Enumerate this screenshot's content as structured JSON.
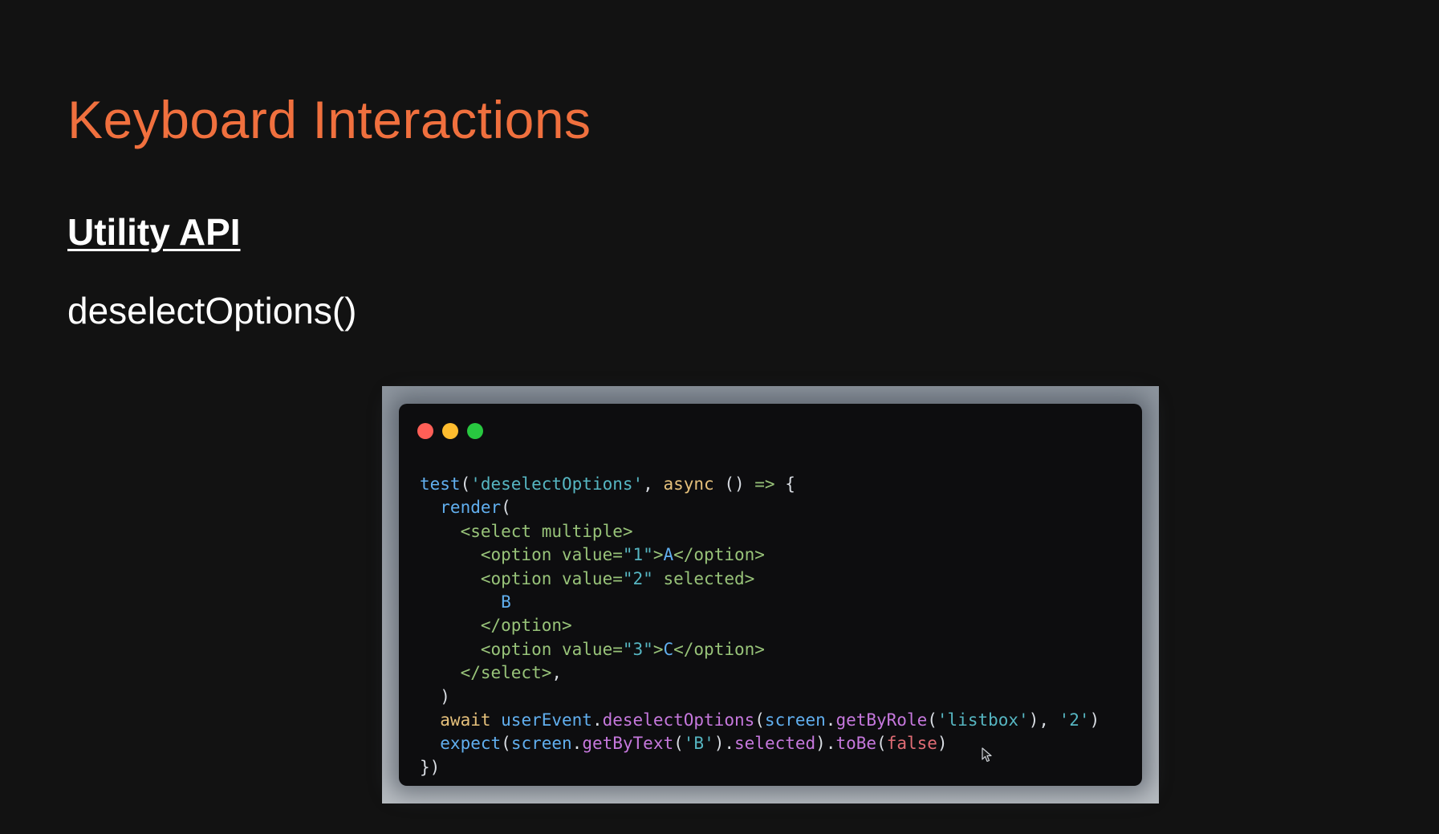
{
  "slide": {
    "title": "Keyboard Interactions",
    "heading": "Utility API",
    "api_name": "deselectOptions()"
  },
  "colors": {
    "background": "#121212",
    "title": "#f0703e",
    "frame": "#9aa1a9",
    "editor_bg": "#0d0d0f",
    "close_dot": "#ff5f57",
    "minimize_dot": "#febc2e",
    "zoom_dot": "#28c840"
  },
  "code_window": {
    "traffic_lights": [
      {
        "name": "close-dot",
        "color": "#ff5f57"
      },
      {
        "name": "minimize-dot",
        "color": "#febc2e"
      },
      {
        "name": "zoom-dot",
        "color": "#28c840"
      }
    ],
    "lines": [
      [
        {
          "t": "test",
          "c": "#61afef"
        },
        {
          "t": "(",
          "c": "#d9dde3"
        },
        {
          "t": "'deselectOptions'",
          "c": "#56b6c2"
        },
        {
          "t": ", ",
          "c": "#d9dde3"
        },
        {
          "t": "async",
          "c": "#e5c07b"
        },
        {
          "t": " () ",
          "c": "#d9dde3"
        },
        {
          "t": "=>",
          "c": "#98c379"
        },
        {
          "t": " {",
          "c": "#d9dde3"
        }
      ],
      [
        {
          "t": "  render",
          "c": "#61afef"
        },
        {
          "t": "(",
          "c": "#d9dde3"
        }
      ],
      [
        {
          "t": "    <select multiple>",
          "c": "#98c379"
        }
      ],
      [
        {
          "t": "      <option value=",
          "c": "#98c379"
        },
        {
          "t": "\"1\"",
          "c": "#56b6c2"
        },
        {
          "t": ">",
          "c": "#98c379"
        },
        {
          "t": "A",
          "c": "#61afef"
        },
        {
          "t": "</option>",
          "c": "#98c379"
        }
      ],
      [
        {
          "t": "      <option value=",
          "c": "#98c379"
        },
        {
          "t": "\"2\"",
          "c": "#56b6c2"
        },
        {
          "t": " selected>",
          "c": "#98c379"
        }
      ],
      [
        {
          "t": "        B",
          "c": "#61afef"
        }
      ],
      [
        {
          "t": "      </option>",
          "c": "#98c379"
        }
      ],
      [
        {
          "t": "      <option value=",
          "c": "#98c379"
        },
        {
          "t": "\"3\"",
          "c": "#56b6c2"
        },
        {
          "t": ">",
          "c": "#98c379"
        },
        {
          "t": "C",
          "c": "#61afef"
        },
        {
          "t": "</option>",
          "c": "#98c379"
        }
      ],
      [
        {
          "t": "    </select>",
          "c": "#98c379"
        },
        {
          "t": ",",
          "c": "#d9dde3"
        }
      ],
      [
        {
          "t": "  )",
          "c": "#d9dde3"
        }
      ],
      [
        {
          "t": "  await",
          "c": "#e5c07b"
        },
        {
          "t": " userEvent",
          "c": "#61afef"
        },
        {
          "t": ".",
          "c": "#d9dde3"
        },
        {
          "t": "deselectOptions",
          "c": "#c678dd"
        },
        {
          "t": "(",
          "c": "#d9dde3"
        },
        {
          "t": "screen",
          "c": "#61afef"
        },
        {
          "t": ".",
          "c": "#d9dde3"
        },
        {
          "t": "getByRole",
          "c": "#c678dd"
        },
        {
          "t": "(",
          "c": "#d9dde3"
        },
        {
          "t": "'listbox'",
          "c": "#56b6c2"
        },
        {
          "t": "), ",
          "c": "#d9dde3"
        },
        {
          "t": "'2'",
          "c": "#56b6c2"
        },
        {
          "t": ")",
          "c": "#d9dde3"
        }
      ],
      [
        {
          "t": "  expect",
          "c": "#61afef"
        },
        {
          "t": "(",
          "c": "#d9dde3"
        },
        {
          "t": "screen",
          "c": "#61afef"
        },
        {
          "t": ".",
          "c": "#d9dde3"
        },
        {
          "t": "getByText",
          "c": "#c678dd"
        },
        {
          "t": "(",
          "c": "#d9dde3"
        },
        {
          "t": "'B'",
          "c": "#56b6c2"
        },
        {
          "t": ").",
          "c": "#d9dde3"
        },
        {
          "t": "selected",
          "c": "#c678dd"
        },
        {
          "t": ").",
          "c": "#d9dde3"
        },
        {
          "t": "toBe",
          "c": "#c678dd"
        },
        {
          "t": "(",
          "c": "#d9dde3"
        },
        {
          "t": "false",
          "c": "#e06c75"
        },
        {
          "t": ")",
          "c": "#d9dde3"
        }
      ],
      [
        {
          "t": "})",
          "c": "#d9dde3"
        }
      ]
    ]
  },
  "icons": {
    "cursor": "mouse-pointer-icon"
  }
}
